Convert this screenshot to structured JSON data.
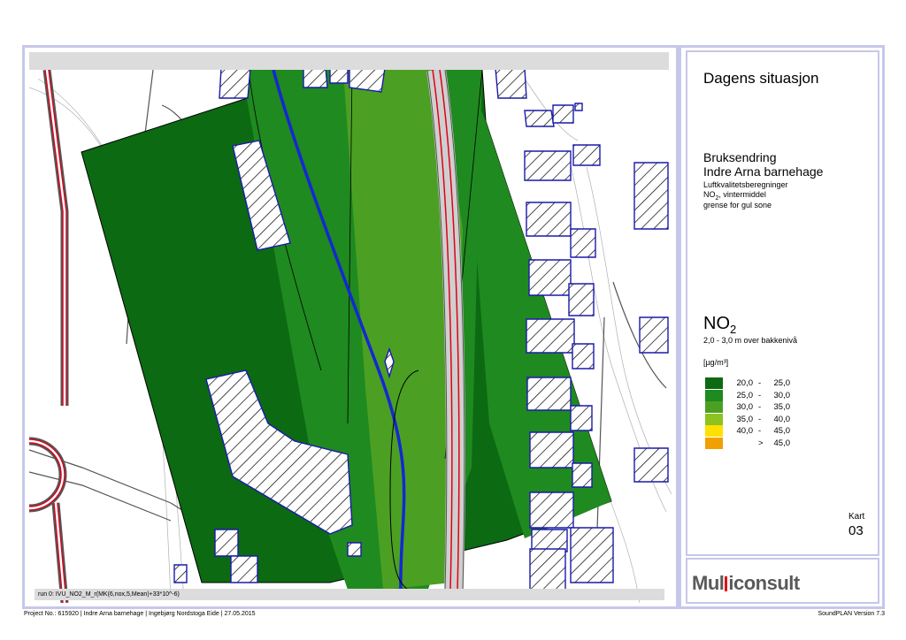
{
  "map": {
    "run_label": "run 0: IVU_NO2_M_r(MK(6,nox,5,Mean)+33*10^-6)",
    "colors": {
      "zone_dark": "#0b6a12",
      "zone_mid": "#1f8a1f",
      "zone_light": "#4ba023",
      "rail_gray": "#c8c8c8",
      "rail_red": "#e0001a",
      "building_outline": "#1a1aaa",
      "waterway": "#1428d2",
      "contour": "#b0b0b0"
    }
  },
  "panel": {
    "title": "Dagens situasjon",
    "subtitle_line1": "Bruksendring",
    "subtitle_line2": "Indre Arna barnehage",
    "detail_line1": "Luftkvalitetsberegninger",
    "detail_line2_main": "NO",
    "detail_line2_sub": "2",
    "detail_line2_rest": ", vintermiddel",
    "detail_line3": "grense for gul sone",
    "pollutant_main": "NO",
    "pollutant_sub": "2",
    "height_text": "2,0 - 3,0 m over bakkenivå",
    "unit": "[µg/m³]",
    "legend": [
      {
        "from": "20,0",
        "dash": "-",
        "to": "25,0",
        "color": "#0b6a12"
      },
      {
        "from": "25,0",
        "dash": "-",
        "to": "30,0",
        "color": "#1f8a1f"
      },
      {
        "from": "30,0",
        "dash": "-",
        "to": "35,0",
        "color": "#4ba023"
      },
      {
        "from": "35,0",
        "dash": "-",
        "to": "40,0",
        "color": "#8dc21f"
      },
      {
        "from": "40,0",
        "dash": "-",
        "to": "45,0",
        "color": "#ffe000"
      },
      {
        "from": "",
        "dash": ">",
        "to": "45,0",
        "color": "#f0a000"
      }
    ],
    "kart_label": "Kart",
    "kart_number": "03"
  },
  "logo": {
    "text_before": "Mul",
    "text_after": "iconsult"
  },
  "footer": {
    "left": "Project No.: 615920 | Indre Arna barnehage | Ingebjørg Nordstoga Eide | 27.05.2015",
    "right": "SoundPLAN Version 7.3"
  }
}
